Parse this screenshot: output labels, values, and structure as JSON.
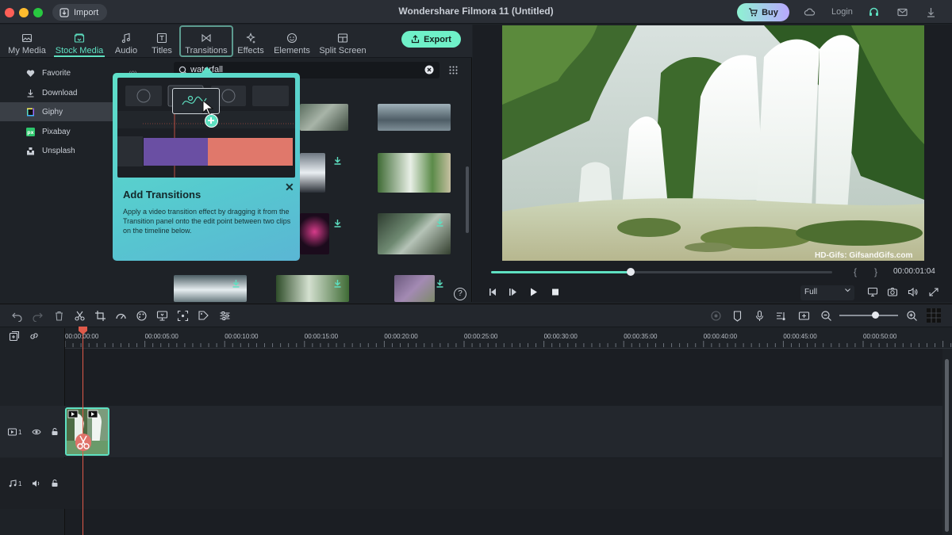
{
  "titlebar": {
    "app_title": "Wondershare Filmora 11 (Untitled)",
    "import_label": "Import",
    "buy_label": "Buy",
    "login_label": "Login"
  },
  "tabs": [
    {
      "label": "My Media",
      "icon": "image-icon"
    },
    {
      "label": "Stock Media",
      "icon": "stock-media-icon",
      "active": true
    },
    {
      "label": "Audio",
      "icon": "music-note-icon"
    },
    {
      "label": "Titles",
      "icon": "title-icon"
    },
    {
      "label": "Transitions",
      "icon": "transition-icon",
      "highlighted": true
    },
    {
      "label": "Effects",
      "icon": "sparkle-icon"
    },
    {
      "label": "Elements",
      "icon": "smiley-icon"
    },
    {
      "label": "Split Screen",
      "icon": "split-screen-icon"
    }
  ],
  "export_label": "Export",
  "sidebar": {
    "count": "(0)",
    "items": [
      {
        "label": "Favorite",
        "icon": "heart-icon"
      },
      {
        "label": "Download",
        "icon": "download-icon"
      },
      {
        "label": "Giphy",
        "icon": "giphy-icon",
        "selected": true
      },
      {
        "label": "Pixabay",
        "icon": "pixabay-icon"
      },
      {
        "label": "Unsplash",
        "icon": "unsplash-icon"
      }
    ]
  },
  "search": {
    "value": "waterfall"
  },
  "tooltip": {
    "title": "Add Transitions",
    "body": "Apply a video transition effect by dragging it from the Transition panel onto the edit point between two clips on the timeline below."
  },
  "preview": {
    "watermark": "HD-Gifs: GifsandGifs.com",
    "timecode": "00:00:01:04",
    "zoom_option": "Full",
    "progress": 0.41
  },
  "timeline": {
    "ruler_labels": [
      "00:00:00:00",
      "00:00:05:00",
      "00:00:10:00",
      "00:00:15:00",
      "00:00:20:00",
      "00:00:25:00",
      "00:00:30:00",
      "00:00:35:00",
      "00:00:40:00",
      "00:00:45:00",
      "00:00:50:00"
    ],
    "video_track_label": "1",
    "audio_track_label": "1"
  },
  "colors": {
    "accent": "#5ee0c1",
    "playhead": "#e05a4a",
    "tooltip": "#5fe0c8"
  }
}
